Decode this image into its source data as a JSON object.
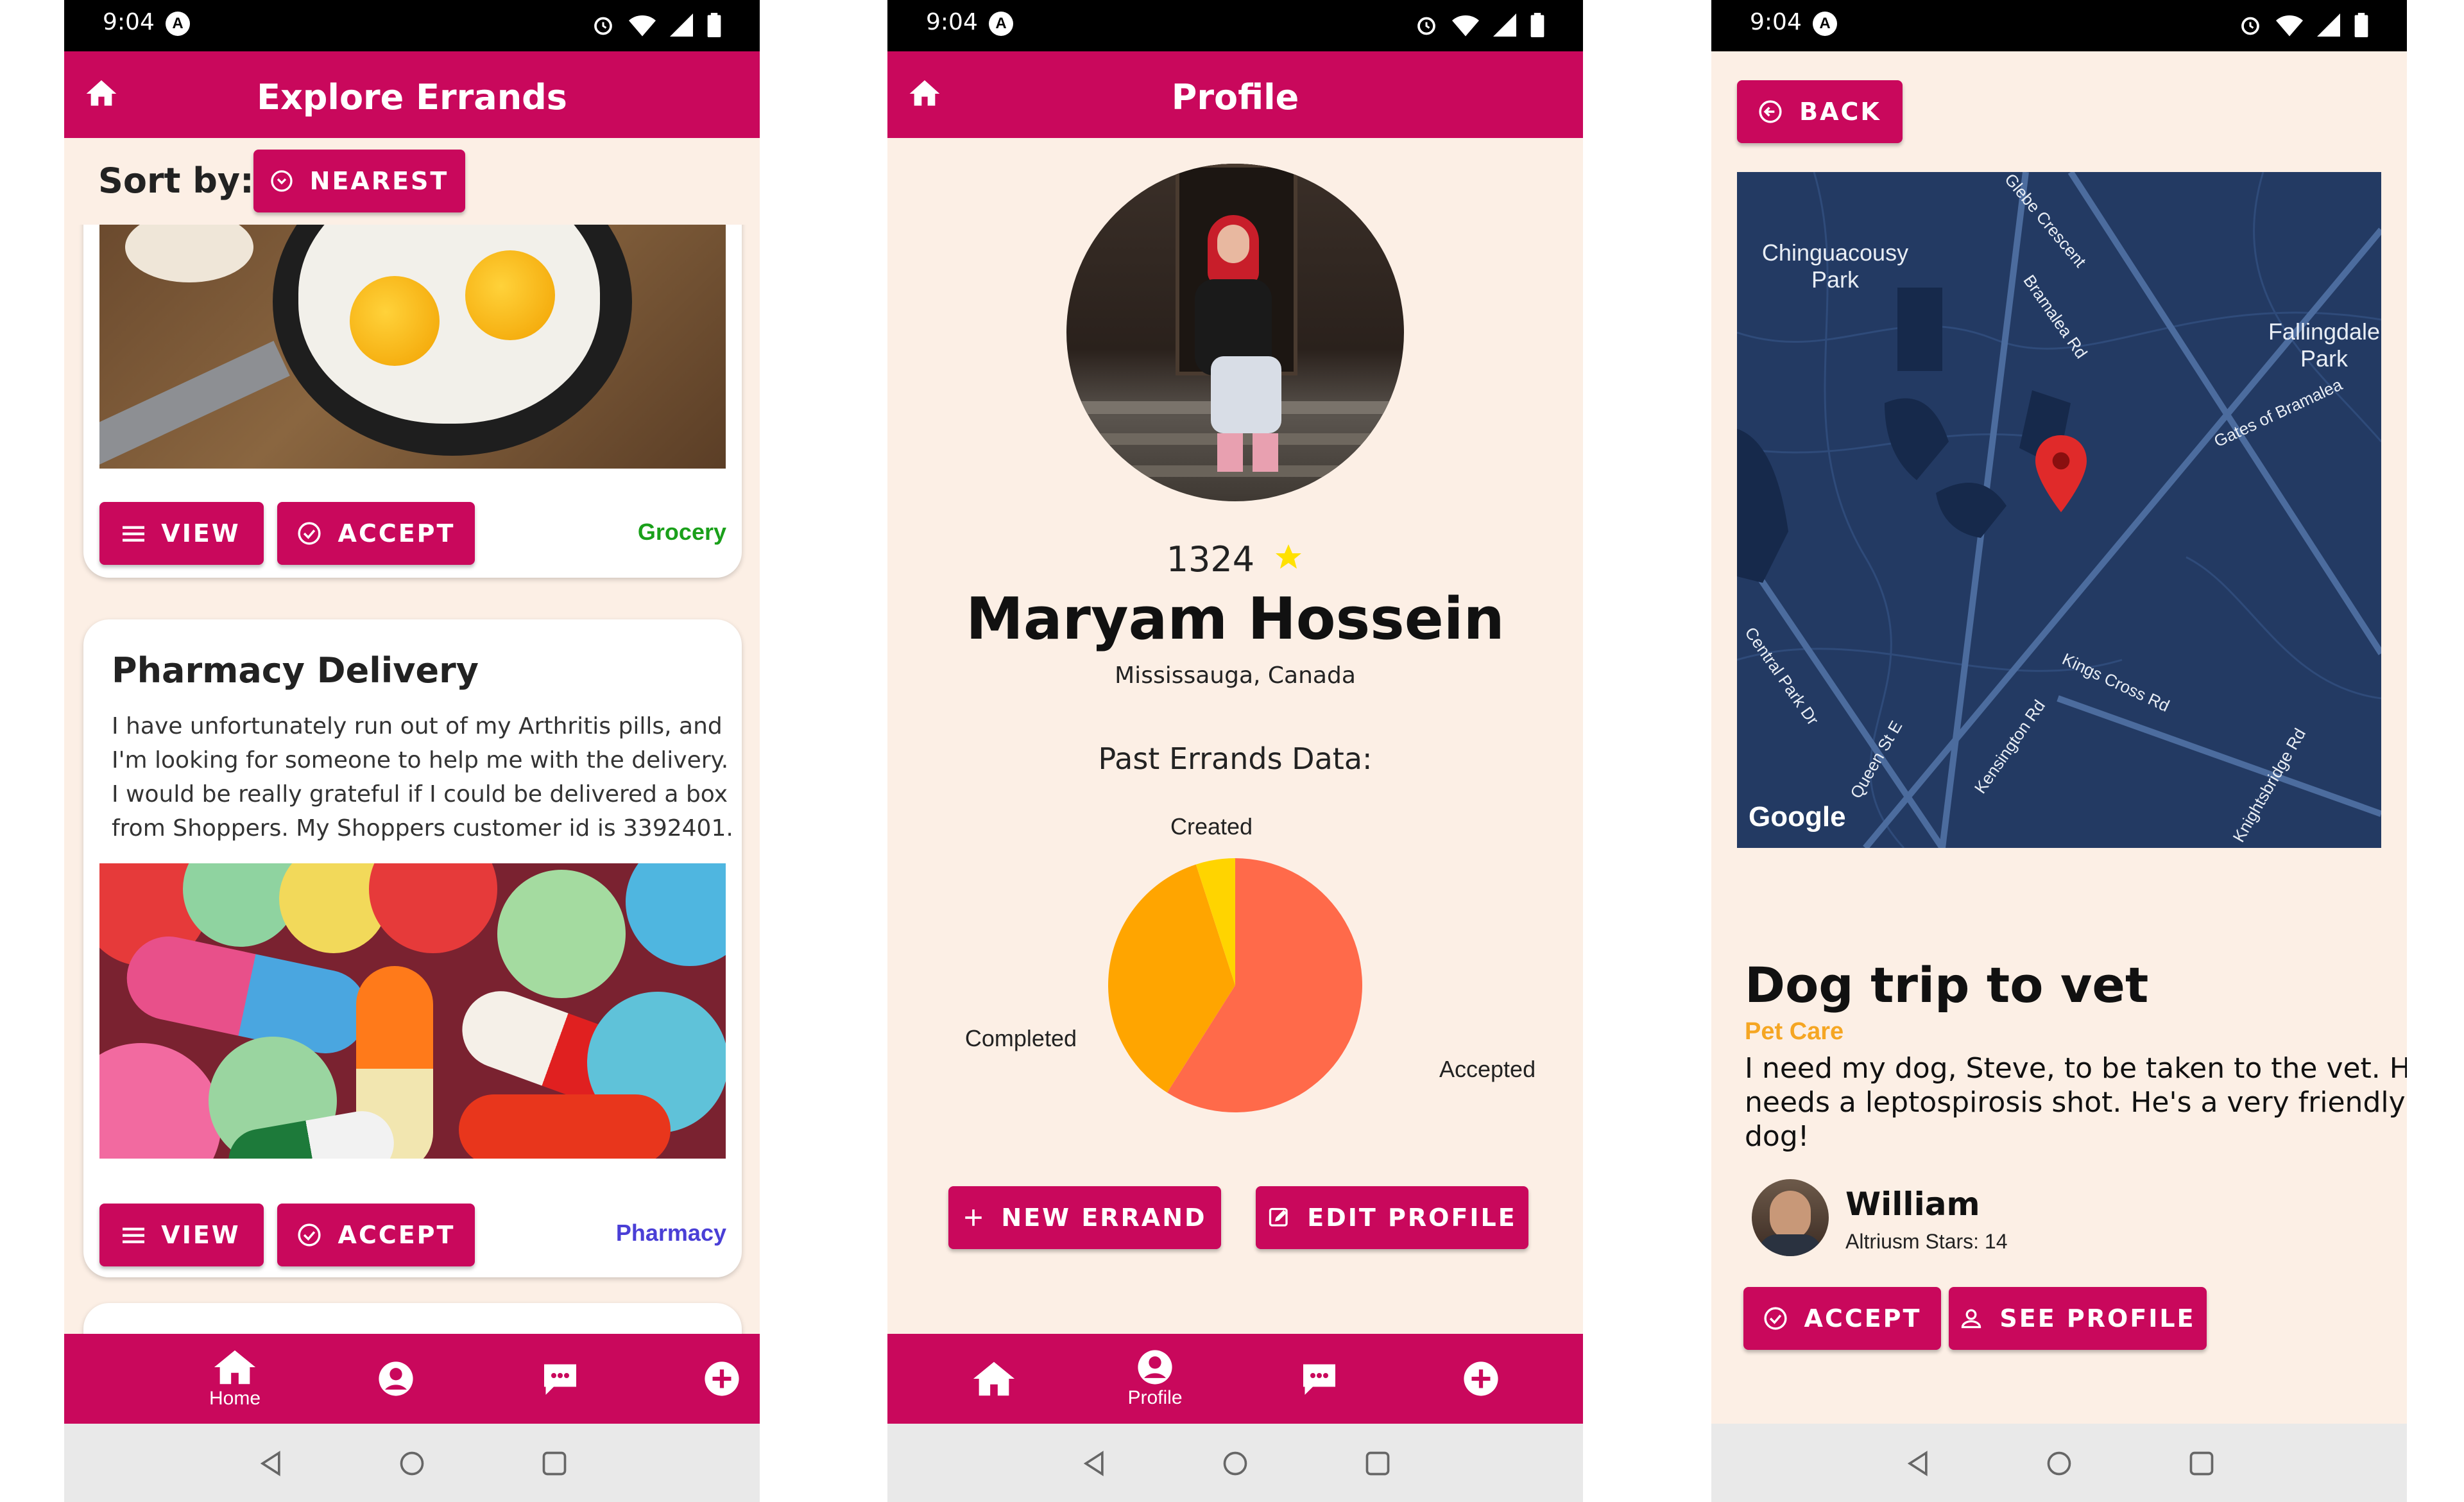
{
  "status": {
    "time": "9:04"
  },
  "explore": {
    "title": "Explore Errands",
    "sort_label": "Sort by:",
    "sort_button": "NEAREST",
    "card1": {
      "view": "VIEW",
      "accept": "ACCEPT",
      "tag": "Grocery"
    },
    "card2": {
      "title": "Pharmacy Delivery",
      "description_lines": [
        "I have unfortunately run out of my Arthritis pills, and",
        "I'm looking for someone to help me with the delivery.",
        "I would be really grateful if I could be delivered a box",
        "from Shoppers. My Shoppers customer id is 3392401."
      ],
      "view": "VIEW",
      "accept": "ACCEPT",
      "tag": "Pharmacy"
    },
    "nav": {
      "home": "Home"
    }
  },
  "profile": {
    "title": "Profile",
    "stars": "1324",
    "name": "Maryam Hossein",
    "location": "Mississauga, Canada",
    "chart_heading": "Past Errands Data:",
    "new_errand": "NEW ERRAND",
    "edit_profile": "EDIT PROFILE",
    "nav": {
      "profile": "Profile"
    }
  },
  "chart_data": {
    "type": "pie",
    "title": "Past Errands Data:",
    "categories": [
      "Accepted",
      "Completed",
      "Created"
    ],
    "values": [
      59,
      36,
      5
    ],
    "colors": [
      "#ff6a4a",
      "#ffa500",
      "#ffd400"
    ],
    "legend": "labels-around"
  },
  "detail": {
    "back": "BACK",
    "map": {
      "labels": [
        "Chinguacousy Park",
        "Fallingdale Park",
        "Glebe Crescent",
        "Bramalea Rd",
        "Gates of Bramalea",
        "Central Park Dr",
        "Queen St E",
        "Kensington Rd",
        "Kings Cross Rd",
        "Knightsbridge Rd"
      ],
      "brand": "Google"
    },
    "title": "Dog trip to vet",
    "category": "Pet Care",
    "description_lines": [
      "I need my dog, Steve, to be taken to the vet. He",
      "needs a leptospirosis shot. He's a very friendly",
      "dog!"
    ],
    "requester": {
      "name": "William",
      "stars": "Altriusm Stars: 14"
    },
    "accept": "ACCEPT",
    "see_profile": "SEE PROFILE"
  },
  "colors": {
    "primary": "#c9085c",
    "background": "#fcefe5",
    "grocery": "#1aa01a",
    "pharmacy": "#4a3fd6",
    "pet_care": "#f5a623",
    "map_bg": "#233a63",
    "star": "#ffd700"
  }
}
